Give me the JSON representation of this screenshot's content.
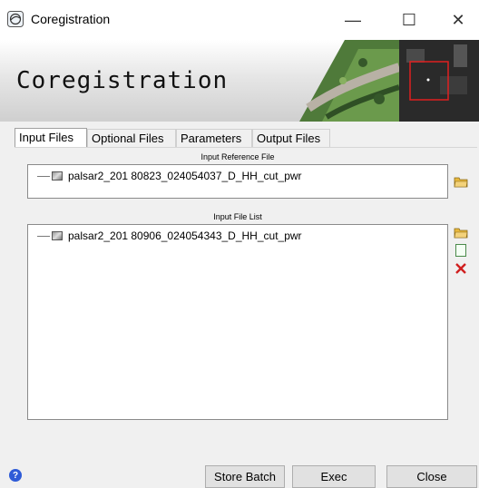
{
  "window": {
    "title": "Coregistration",
    "controls": {
      "minimize": "—",
      "maximize": "☐",
      "close": "✕"
    }
  },
  "banner": {
    "title": "Coregistration"
  },
  "tabs": [
    {
      "label": "Input Files",
      "active": true
    },
    {
      "label": "Optional Files",
      "active": false
    },
    {
      "label": "Parameters",
      "active": false
    },
    {
      "label": "Output Files",
      "active": false
    }
  ],
  "input_reference": {
    "label": "Input Reference File",
    "items": [
      "palsar2_201 80823_024054037_D_HH_cut_pwr"
    ]
  },
  "input_list": {
    "label": "Input File List",
    "items": [
      "palsar2_201 80906_024054343_D_HH_cut_pwr"
    ]
  },
  "icons": {
    "app": "satellite-app-icon",
    "open_reference": "open-folder-icon",
    "open_list": "open-folder-icon",
    "new_list": "new-file-icon",
    "remove": "delete-x-icon",
    "help": "help-icon"
  },
  "help": {
    "glyph": "?"
  },
  "buttons": {
    "store_batch": "Store Batch",
    "exec": "Exec",
    "close": "Close"
  },
  "colors": {
    "accent": "#2e5bd7",
    "remove": "#d02020",
    "folder": "#e7b83c"
  }
}
